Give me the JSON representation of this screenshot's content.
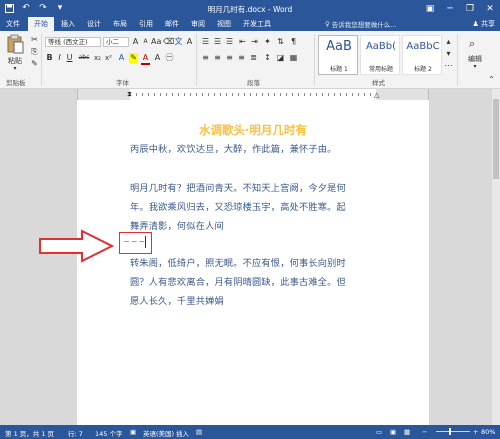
{
  "titlebar": {
    "title": "明月几时有.docx - Word",
    "qat": [
      "save-icon",
      "undo-icon",
      "redo-icon",
      "customize-icon"
    ],
    "min": "─",
    "restore": "❐",
    "close": "✕"
  },
  "tabs": [
    "文件",
    "开始",
    "插入",
    "设计",
    "布局",
    "引用",
    "邮件",
    "审阅",
    "视图",
    "开发工具"
  ],
  "active_tab": "开始",
  "tell_me": "告诉我您想要做什么...",
  "share": "共享",
  "ribbon": {
    "paste_label": "粘贴",
    "clipboard_label": "剪贴板",
    "font_name": "等线 (西文正)",
    "font_size": "小二",
    "font_group_label": "字体",
    "paragraph_label": "段落",
    "styles_label": "样式",
    "edit_label": "编辑",
    "styles": [
      {
        "sample": "AaB",
        "name": "标题 1"
      },
      {
        "sample": "AaBb(",
        "name": "常用标题"
      },
      {
        "sample": "AaBbC",
        "name": "标题 2"
      }
    ],
    "font_buttons": [
      "B",
      "I",
      "U",
      "abc",
      "x₂",
      "x²",
      "A",
      "A"
    ]
  },
  "document": {
    "title": "水调歌头·明月几时有",
    "preface": "丙辰中秋，欢饮达旦，大醉，作此篇，兼怀子由。",
    "stanza1": [
      "明月几时有？把酒问青天。不知天上宫阙，今夕是何",
      "年。我欲乘风归去，又恐琼楼玉宇，高处不胜寒。起",
      "舞弄清影，何似在人间"
    ],
    "inserted_mark": "−−−",
    "stanza2": [
      "转朱阁，低绮户，照无眠。不应有恨，何事长向别时",
      "圆？人有悲欢离合，月有阴晴圆缺，此事古难全。但",
      "愿人长久，千里共婵娟"
    ]
  },
  "status": {
    "page": "第 1 页，共 1 页",
    "line": "行: 7",
    "chars": "145 个字",
    "language": "英语(美国)",
    "mode": "插入",
    "zoom": "80%"
  },
  "colors": {
    "accent": "#2b579a",
    "title": "#f7c143",
    "body": "#3b5a8a",
    "annotation": "#e03030"
  }
}
